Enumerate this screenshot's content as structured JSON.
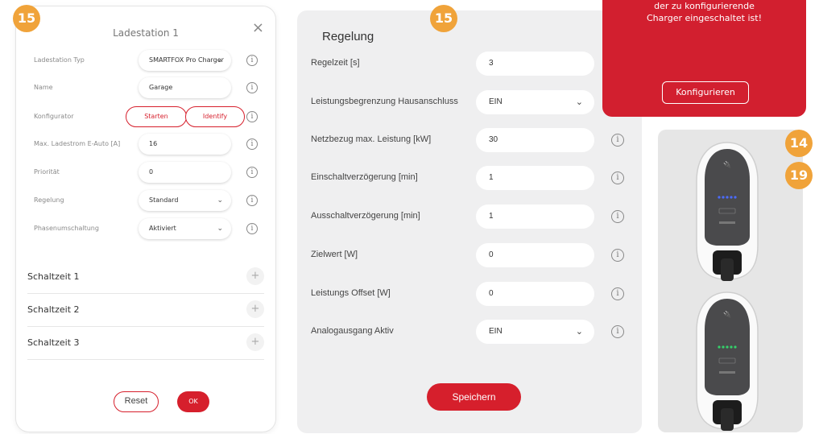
{
  "badges": {
    "left": "15",
    "middle": "15",
    "right_top": "14",
    "right_bottom": "19"
  },
  "dialog": {
    "title": "Ladestation 1",
    "close": "×",
    "fields": [
      {
        "label": "Ladestation Typ",
        "value": "SMARTFOX Pro Charger",
        "type": "select"
      },
      {
        "label": "Name",
        "value": "Garage",
        "type": "input"
      },
      {
        "label": "Konfigurator",
        "type": "buttons",
        "buttons": [
          "Starten",
          "Identify"
        ]
      },
      {
        "label": "Max. Ladestrom E-Auto [A]",
        "value": "16",
        "type": "input"
      },
      {
        "label": "Priorität",
        "value": "0",
        "type": "input"
      },
      {
        "label": "Regelung",
        "value": "Standard",
        "type": "select"
      },
      {
        "label": "Phasenumschaltung",
        "value": "Aktiviert",
        "type": "select"
      }
    ],
    "sections": [
      "Schaltzeit 1",
      "Schaltzeit 2",
      "Schaltzeit 3"
    ],
    "reset_label": "Reset",
    "ok_label": "OK"
  },
  "regelung": {
    "title": "Regelung",
    "rows": [
      {
        "label": "Regelzeit [s]",
        "value": "3",
        "type": "input"
      },
      {
        "label": "Leistungsbegrenzung Hausanschluss",
        "value": "EIN",
        "type": "select"
      },
      {
        "label": "Netzbezug max. Leistung [kW]",
        "value": "30",
        "type": "input"
      },
      {
        "label": "Einschaltverzögerung [min]",
        "value": "1",
        "type": "input"
      },
      {
        "label": "Ausschaltverzögerung [min]",
        "value": "1",
        "type": "input"
      },
      {
        "label": "Zielwert [W]",
        "value": "0",
        "type": "input"
      },
      {
        "label": "Leistungs Offset [W]",
        "value": "0",
        "type": "input"
      },
      {
        "label": "Analogausgang Aktiv",
        "value": "EIN",
        "type": "select"
      }
    ],
    "save_label": "Speichern"
  },
  "notice": {
    "line1": "der zu konfigurierende",
    "line2": "Charger eingeschaltet ist!",
    "button": "Konfigurieren"
  },
  "icons": {
    "info": "i",
    "chevron": "⌄",
    "plus": "+"
  },
  "colors": {
    "accent_red": "#d61f2c",
    "badge_orange": "#f0a33a",
    "led_blue": "#4b6cff",
    "led_green": "#35d06a"
  }
}
